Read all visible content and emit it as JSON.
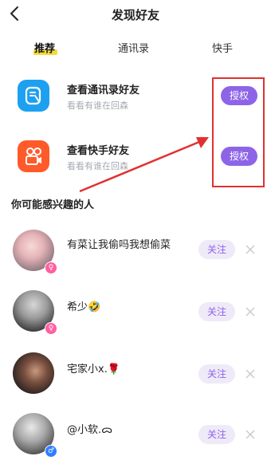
{
  "header": {
    "title": "发现好友"
  },
  "tabs": [
    {
      "label": "推荐",
      "active": true
    },
    {
      "label": "通讯录",
      "active": false
    },
    {
      "label": "快手",
      "active": false
    }
  ],
  "cards": [
    {
      "title": "查看通讯录好友",
      "subtitle": "看看有谁在回森",
      "button": "授权",
      "icon": "contacts-app-icon",
      "color": "#1ea0f0"
    },
    {
      "title": "查看快手好友",
      "subtitle": "看看有谁在回森",
      "button": "授权",
      "icon": "kuaishou-app-icon",
      "color": "#ff5a2a"
    }
  ],
  "section_title": "你可能感兴趣的人",
  "users": [
    {
      "name": "有菜让我偷吗我想偷菜",
      "gender": "female",
      "button": "关注"
    },
    {
      "name": "希少🤣",
      "gender": "female",
      "button": "关注"
    },
    {
      "name": "宅家小x.🌹",
      "gender": "none",
      "button": "关注"
    },
    {
      "name": "@小软.ᯅ",
      "gender": "male",
      "button": "关注"
    }
  ],
  "colors": {
    "accent": "#8d64e8",
    "tab_underline": "#f5db3b",
    "annotation": "#e23030"
  }
}
